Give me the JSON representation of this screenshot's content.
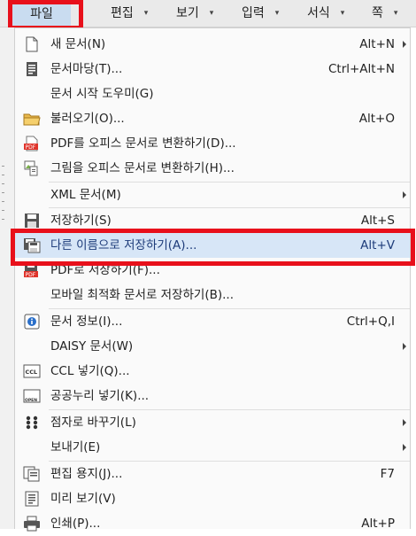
{
  "menubar": {
    "file": "파일",
    "edit": "편집",
    "view": "보기",
    "input": "입력",
    "format": "서식",
    "page": "쪽"
  },
  "menu": {
    "new_doc": {
      "label": "새 문서(N)",
      "shortcut": "Alt+N",
      "icon": "new-document-icon"
    },
    "doc_template": {
      "label": "문서마당(T)...",
      "shortcut": "Ctrl+Alt+N",
      "icon": "template-icon"
    },
    "doc_wizard": {
      "label": "문서 시작 도우미(G)"
    },
    "open": {
      "label": "불러오기(O)...",
      "shortcut": "Alt+O",
      "icon": "folder-icon"
    },
    "pdf_convert": {
      "label": "PDF를 오피스 문서로 변환하기(D)...",
      "icon": "pdf-icon"
    },
    "image_convert": {
      "label": "그림을 오피스 문서로 변환하기(H)...",
      "icon": "image-convert-icon"
    },
    "xml_doc": {
      "label": "XML 문서(M)"
    },
    "save": {
      "label": "저장하기(S)",
      "shortcut": "Alt+S",
      "icon": "save-icon"
    },
    "save_as": {
      "label": "다른 이름으로 저장하기(A)...",
      "shortcut": "Alt+V",
      "icon": "save-as-icon"
    },
    "save_pdf": {
      "label": "PDF로 저장하기(F)...",
      "icon": "save-pdf-icon"
    },
    "save_mobile": {
      "label": "모바일 최적화 문서로 저장하기(B)..."
    },
    "doc_info": {
      "label": "문서 정보(I)...",
      "shortcut": "Ctrl+Q,I",
      "icon": "info-icon"
    },
    "daisy": {
      "label": "DAISY 문서(W)"
    },
    "ccl": {
      "label": "CCL 넣기(Q)...",
      "icon": "ccl-icon"
    },
    "open_license": {
      "label": "공공누리 넣기(K)...",
      "icon": "open-license-icon"
    },
    "braille": {
      "label": "점자로 바꾸기(L)",
      "icon": "braille-icon"
    },
    "send": {
      "label": "보내기(E)"
    },
    "page_setup": {
      "label": "편집 용지(J)...",
      "shortcut": "F7",
      "icon": "page-setup-icon"
    },
    "preview": {
      "label": "미리 보기(V)",
      "icon": "preview-icon"
    },
    "print": {
      "label": "인쇄(P)...",
      "shortcut": "Alt+P",
      "icon": "print-icon"
    }
  },
  "colors": {
    "highlight_border": "#e8101b",
    "hover_bg": "#d7e6f7",
    "file_menu_active_bg": "#c9dcf0"
  }
}
